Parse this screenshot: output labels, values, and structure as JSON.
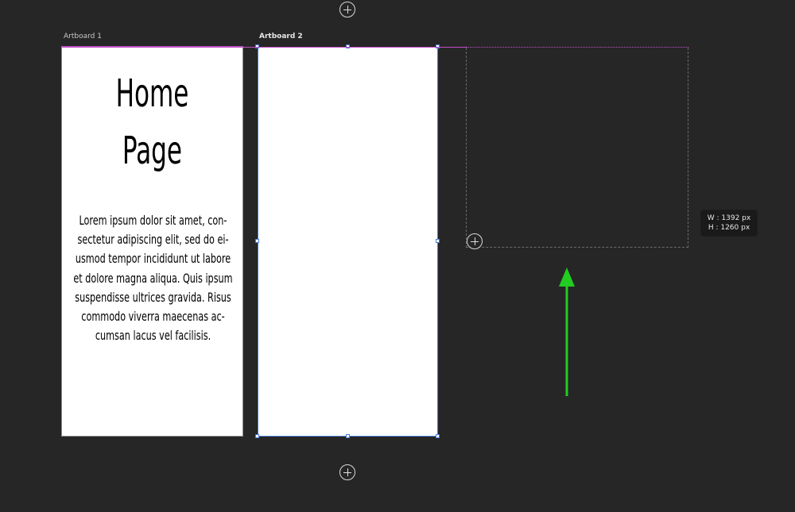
{
  "canvas": {
    "artboards": [
      {
        "label": "Artboard 1",
        "title": "Home\nPage",
        "body": "Lorem ipsum dolor sit amet, con-\nsectetur adipiscing elit, sed do ei-\nusmod tempor incididunt ut labore\net dolore magna aliqua. Quis ipsum\nsuspendisse ultrices gravida. Risus\ncommodo viverra maecenas ac-\ncumsan lacus vel facilisis."
      },
      {
        "label": "Artboard 2",
        "selected": true
      }
    ],
    "size_tooltip": {
      "width_text": "W :  1392 px",
      "height_text": "H :  1260 px"
    }
  },
  "icons": {
    "add_artboard": "plus-circle-icon",
    "annotation_arrow": "arrow-up-icon"
  },
  "colors": {
    "background": "#262626",
    "artboard_fill": "#ffffff",
    "selection_outline": "#4a7fd4",
    "smart_guide": "#c04ec8",
    "annotation_arrow": "#22cc22"
  }
}
